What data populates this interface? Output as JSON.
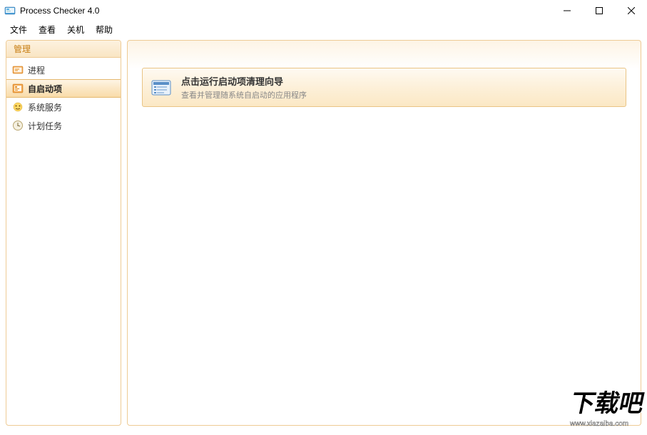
{
  "window": {
    "title": "Process Checker 4.0"
  },
  "menu": {
    "items": [
      "文件",
      "查看",
      "关机",
      "帮助"
    ]
  },
  "sidebar": {
    "header": "管理",
    "items": [
      {
        "label": "进程",
        "icon": "process-icon",
        "active": false
      },
      {
        "label": "自启动项",
        "icon": "startup-icon",
        "active": true
      },
      {
        "label": "系统服务",
        "icon": "services-icon",
        "active": false
      },
      {
        "label": "计划任务",
        "icon": "scheduled-icon",
        "active": false
      }
    ]
  },
  "main": {
    "card": {
      "title": "点击运行启动项清理向导",
      "desc": "查看并管理随系统自启动的应用程序"
    }
  },
  "watermark": {
    "text": "下载吧",
    "url": "www.xiazaiba.com"
  }
}
